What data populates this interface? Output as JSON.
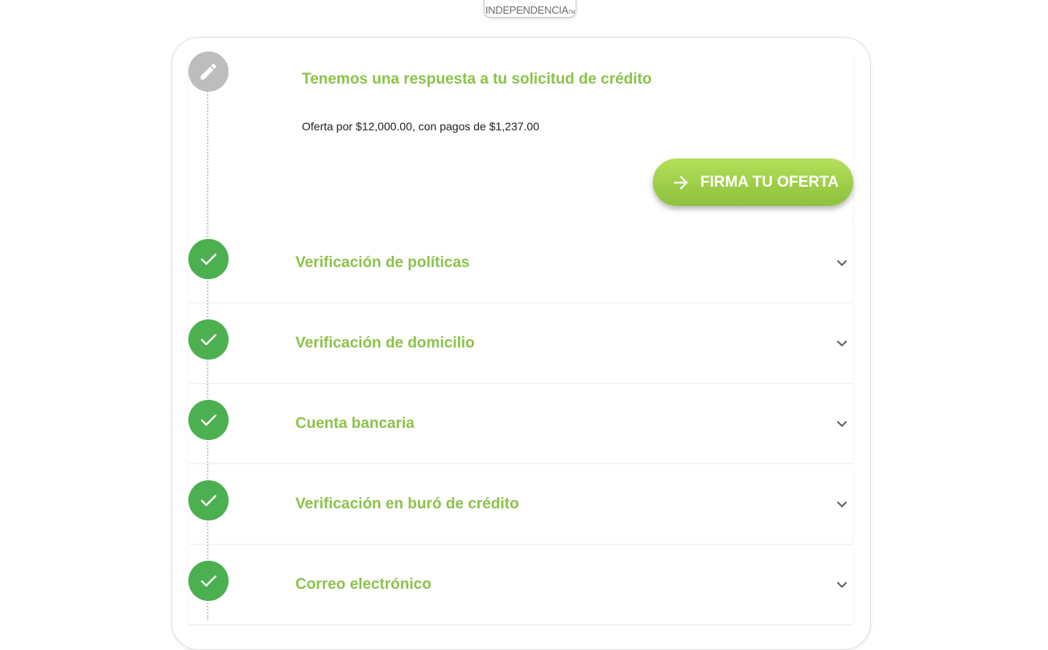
{
  "brand": {
    "logo_text": "INDEPENDENCIA",
    "logo_mark": "TM"
  },
  "active_step": {
    "title": "Tenemos una respuesta a tu solicitud de crédito",
    "body": "Oferta por $12,000.00, con pagos de $1,237.00",
    "button_label": "FIRMA TU OFERTA",
    "button_icon": "arrow-right-icon",
    "status_icon": "pencil-icon"
  },
  "steps": [
    {
      "title": "Verificación de políticas",
      "status": "completed",
      "status_icon": "check-icon",
      "toggle_icon": "chevron-down-icon"
    },
    {
      "title": "Verificación de domicilio",
      "status": "completed",
      "status_icon": "check-icon",
      "toggle_icon": "chevron-down-icon"
    },
    {
      "title": "Cuenta bancaria",
      "status": "completed",
      "status_icon": "check-icon",
      "toggle_icon": "chevron-down-icon"
    },
    {
      "title": "Verificación en buró de crédito",
      "status": "completed",
      "status_icon": "check-icon",
      "toggle_icon": "chevron-down-icon"
    },
    {
      "title": "Correo electrónico",
      "status": "completed",
      "status_icon": "check-icon",
      "toggle_icon": "chevron-down-icon"
    }
  ],
  "colors": {
    "accent_green": "#8bc34a",
    "completed_green": "#4caf50",
    "pending_gray": "#bdbdbd",
    "button_gradient_top": "#b5e05c",
    "button_gradient_bottom": "#8fc13f"
  }
}
